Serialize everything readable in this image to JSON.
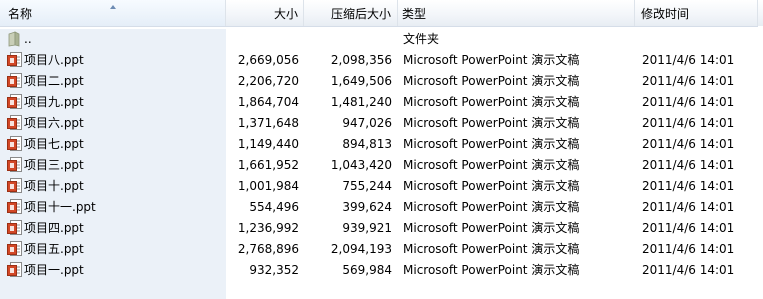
{
  "columns": {
    "name": "名称",
    "size": "大小",
    "compressed": "压缩后大小",
    "type": "类型",
    "modified": "修改时间"
  },
  "sort": {
    "column": "name",
    "direction": "ascending",
    "icon": "sort-up-arrow-icon"
  },
  "parent_row": {
    "name": "..",
    "type": "文件夹",
    "icon": "folder-up-icon"
  },
  "files": [
    {
      "name": "项目八.ppt",
      "size": "2,669,056",
      "compressed": "2,098,356",
      "type": "Microsoft PowerPoint 演示文稿",
      "modified": "2011/4/6 14:01"
    },
    {
      "name": "项目二.ppt",
      "size": "2,206,720",
      "compressed": "1,649,506",
      "type": "Microsoft PowerPoint 演示文稿",
      "modified": "2011/4/6 14:01"
    },
    {
      "name": "项目九.ppt",
      "size": "1,864,704",
      "compressed": "1,481,240",
      "type": "Microsoft PowerPoint 演示文稿",
      "modified": "2011/4/6 14:01"
    },
    {
      "name": "项目六.ppt",
      "size": "1,371,648",
      "compressed": "947,026",
      "type": "Microsoft PowerPoint 演示文稿",
      "modified": "2011/4/6 14:01"
    },
    {
      "name": "项目七.ppt",
      "size": "1,149,440",
      "compressed": "894,813",
      "type": "Microsoft PowerPoint 演示文稿",
      "modified": "2011/4/6 14:01"
    },
    {
      "name": "项目三.ppt",
      "size": "1,661,952",
      "compressed": "1,043,420",
      "type": "Microsoft PowerPoint 演示文稿",
      "modified": "2011/4/6 14:01"
    },
    {
      "name": "项目十.ppt",
      "size": "1,001,984",
      "compressed": "755,244",
      "type": "Microsoft PowerPoint 演示文稿",
      "modified": "2011/4/6 14:01"
    },
    {
      "name": "项目十一.ppt",
      "size": "554,496",
      "compressed": "399,624",
      "type": "Microsoft PowerPoint 演示文稿",
      "modified": "2011/4/6 14:01"
    },
    {
      "name": "项目四.ppt",
      "size": "1,236,992",
      "compressed": "939,921",
      "type": "Microsoft PowerPoint 演示文稿",
      "modified": "2011/4/6 14:01"
    },
    {
      "name": "项目五.ppt",
      "size": "2,768,896",
      "compressed": "2,094,193",
      "type": "Microsoft PowerPoint 演示文稿",
      "modified": "2011/4/6 14:01"
    },
    {
      "name": "项目一.ppt",
      "size": "932,352",
      "compressed": "569,984",
      "type": "Microsoft PowerPoint 演示文稿",
      "modified": "2011/4/6 14:01"
    }
  ],
  "file_icon": "powerpoint-file-icon",
  "colors": {
    "name_column_bg": "#ebf1f8",
    "header_bg": "#f3f6fa",
    "folder_icon": "#b7bfa5",
    "ppt_icon": "#d24726"
  }
}
